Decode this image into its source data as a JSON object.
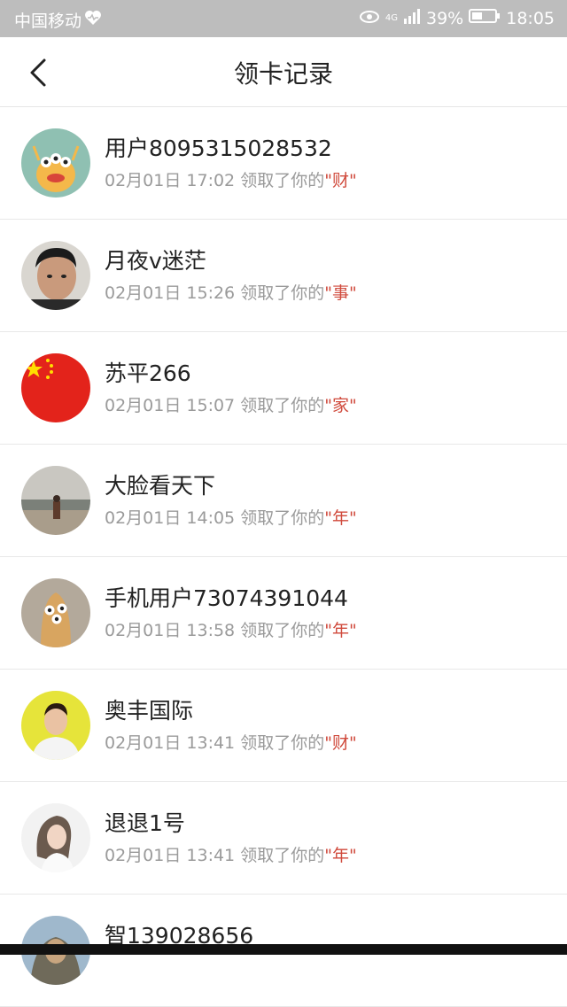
{
  "status_bar": {
    "carrier": "中国移动",
    "network": "4G",
    "battery": "39%",
    "time": "18:05",
    "icons": [
      "heart-icon",
      "eye-icon",
      "signal-icon",
      "battery-icon"
    ]
  },
  "header": {
    "title": "领卡记录",
    "back_icon": "chevron-left-icon"
  },
  "records": [
    {
      "name": "用户8095315028532",
      "time": "02月01日 17:02",
      "action": "领取了你的",
      "card": "\"财\""
    },
    {
      "name": "月夜v迷茫",
      "time": "02月01日 15:26",
      "action": "领取了你的",
      "card": "\"事\""
    },
    {
      "name": "苏平266",
      "time": "02月01日 15:07",
      "action": "领取了你的",
      "card": "\"家\""
    },
    {
      "name": "大脸看天下",
      "time": "02月01日 14:05",
      "action": "领取了你的",
      "card": "\"年\""
    },
    {
      "name": "手机用户73074391044",
      "time": "02月01日 13:58",
      "action": "领取了你的",
      "card": "\"年\""
    },
    {
      "name": "奥丰国际",
      "time": "02月01日 13:41",
      "action": "领取了你的",
      "card": "\"财\""
    },
    {
      "name": "退退1号",
      "time": "02月01日 13:41",
      "action": "领取了你的",
      "card": "\"年\""
    },
    {
      "name": "智139028656",
      "time": "",
      "action": "",
      "card": ""
    }
  ],
  "colors": {
    "card_text": "#d04a3c",
    "status_bar": "#bdbdbd",
    "secondary_text": "#9a9a9a"
  }
}
